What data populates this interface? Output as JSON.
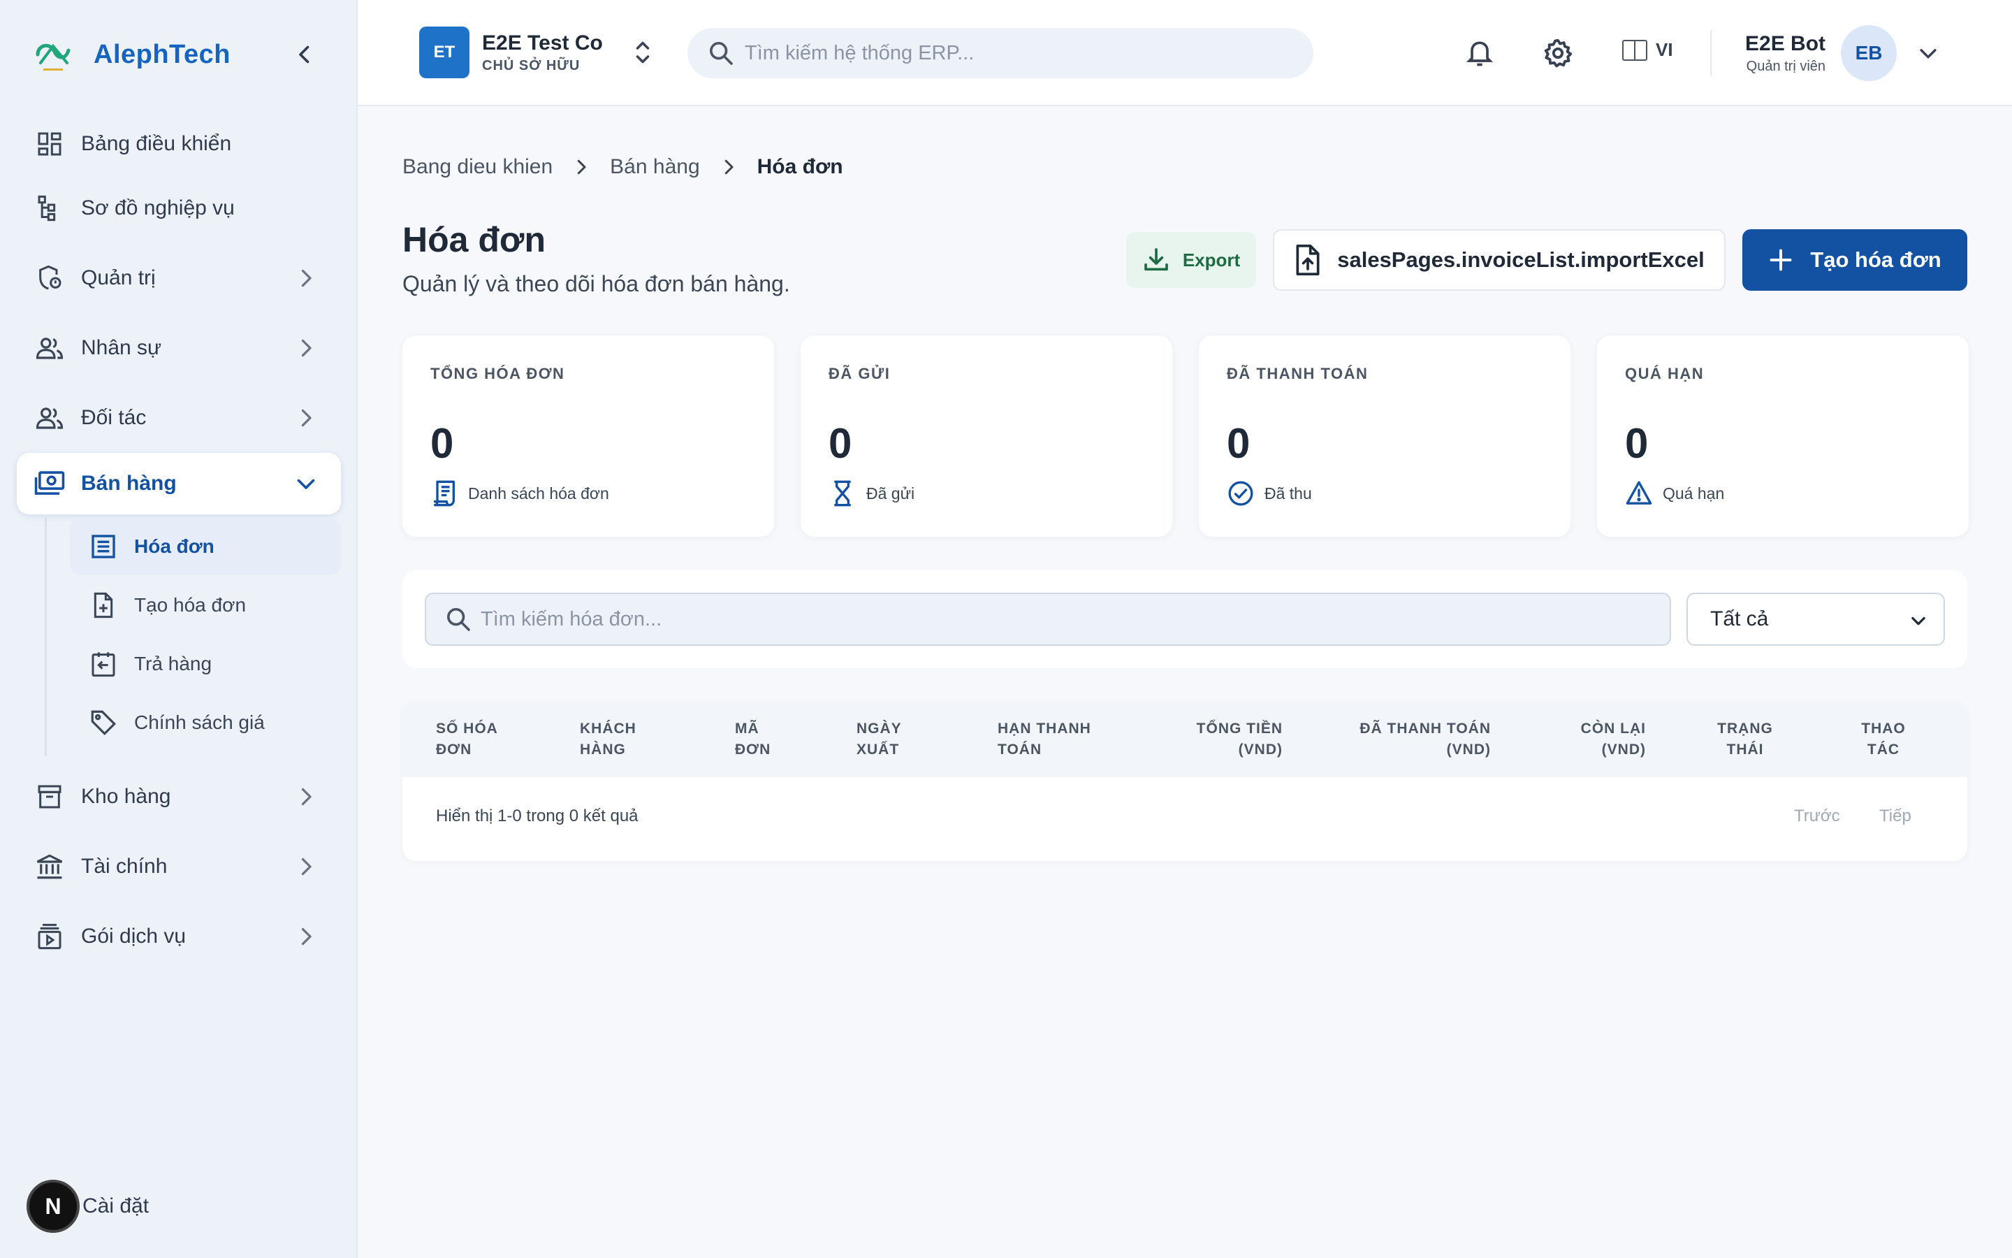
{
  "brand": {
    "name": "AlephTech",
    "accent": "#1565c0",
    "logo_color": "#1fa67a"
  },
  "sidebar": {
    "items": [
      {
        "label": "Bảng điều khiển",
        "icon": "dashboard-icon"
      },
      {
        "label": "Sơ đồ nghiệp vụ",
        "icon": "workflow-icon"
      },
      {
        "label": "Quản trị",
        "icon": "admin-shield-icon",
        "expandable": true
      },
      {
        "label": "Nhân sự",
        "icon": "people-icon",
        "expandable": true
      },
      {
        "label": "Đối tác",
        "icon": "partners-icon",
        "expandable": true
      },
      {
        "label": "Bán hàng",
        "icon": "sales-money-icon",
        "expandable": true,
        "expanded": true,
        "active": true
      },
      {
        "label": "Kho hàng",
        "icon": "warehouse-icon",
        "expandable": true
      },
      {
        "label": "Tài chính",
        "icon": "bank-icon",
        "expandable": true
      },
      {
        "label": "Gói dịch vụ",
        "icon": "service-package-icon",
        "expandable": true
      }
    ],
    "sub_items": [
      {
        "label": "Hóa đơn",
        "icon": "invoice-list-icon",
        "active": true
      },
      {
        "label": "Tạo hóa đơn",
        "icon": "create-invoice-icon"
      },
      {
        "label": "Trả hàng",
        "icon": "return-icon"
      },
      {
        "label": "Chính sách giá",
        "icon": "price-tag-icon"
      }
    ],
    "settings_label": "Cài đặt",
    "settings_avatar": "N"
  },
  "topbar": {
    "company_initials": "ET",
    "company_name": "E2E Test Co",
    "company_role": "CHỦ SỞ HỮU",
    "search_placeholder": "Tìm kiếm hệ thống ERP...",
    "language": "VI",
    "user_name": "E2E Bot",
    "user_role": "Quản trị viên",
    "user_initials": "EB"
  },
  "breadcrumb": [
    "Bang dieu khien",
    "Bán hàng",
    "Hóa đơn"
  ],
  "page": {
    "title": "Hóa đơn",
    "subtitle": "Quản lý và theo dõi hóa đơn bán hàng.",
    "export_label": "Export",
    "import_label": "salesPages.invoiceList.importExcel",
    "create_label": "Tạo hóa đơn"
  },
  "stats": [
    {
      "label": "TỔNG HÓA ĐƠN",
      "value": "0",
      "hint": "Danh sách hóa đơn",
      "icon": "receipt-icon"
    },
    {
      "label": "ĐÃ GỬI",
      "value": "0",
      "hint": "Đã gửi",
      "icon": "hourglass-icon"
    },
    {
      "label": "ĐÃ THANH TOÁN",
      "value": "0",
      "hint": "Đã thu",
      "icon": "check-circle-icon"
    },
    {
      "label": "QUÁ HẠN",
      "value": "0",
      "hint": "Quá hạn",
      "icon": "warning-icon"
    }
  ],
  "filters": {
    "search_placeholder": "Tìm kiếm hóa đơn...",
    "status_selected": "Tất cả"
  },
  "table": {
    "columns": [
      "Số hóa đơn",
      "Khách hàng",
      "Mã đơn",
      "Ngày xuất",
      "Hạn thanh toán",
      "Tổng tiền (VND)",
      "Đã thanh toán (VND)",
      "Còn lại (VND)",
      "Trạng thái",
      "Thao tác"
    ],
    "rows": [],
    "summary": "Hiển thị 1-0 trong 0 kết quả",
    "prev_label": "Trước",
    "next_label": "Tiếp"
  },
  "colors": {
    "primary": "#1351a3",
    "export_bg": "#e8f5ee",
    "export_text": "#1b6b43",
    "sidebar_bg": "#edf2f9"
  }
}
